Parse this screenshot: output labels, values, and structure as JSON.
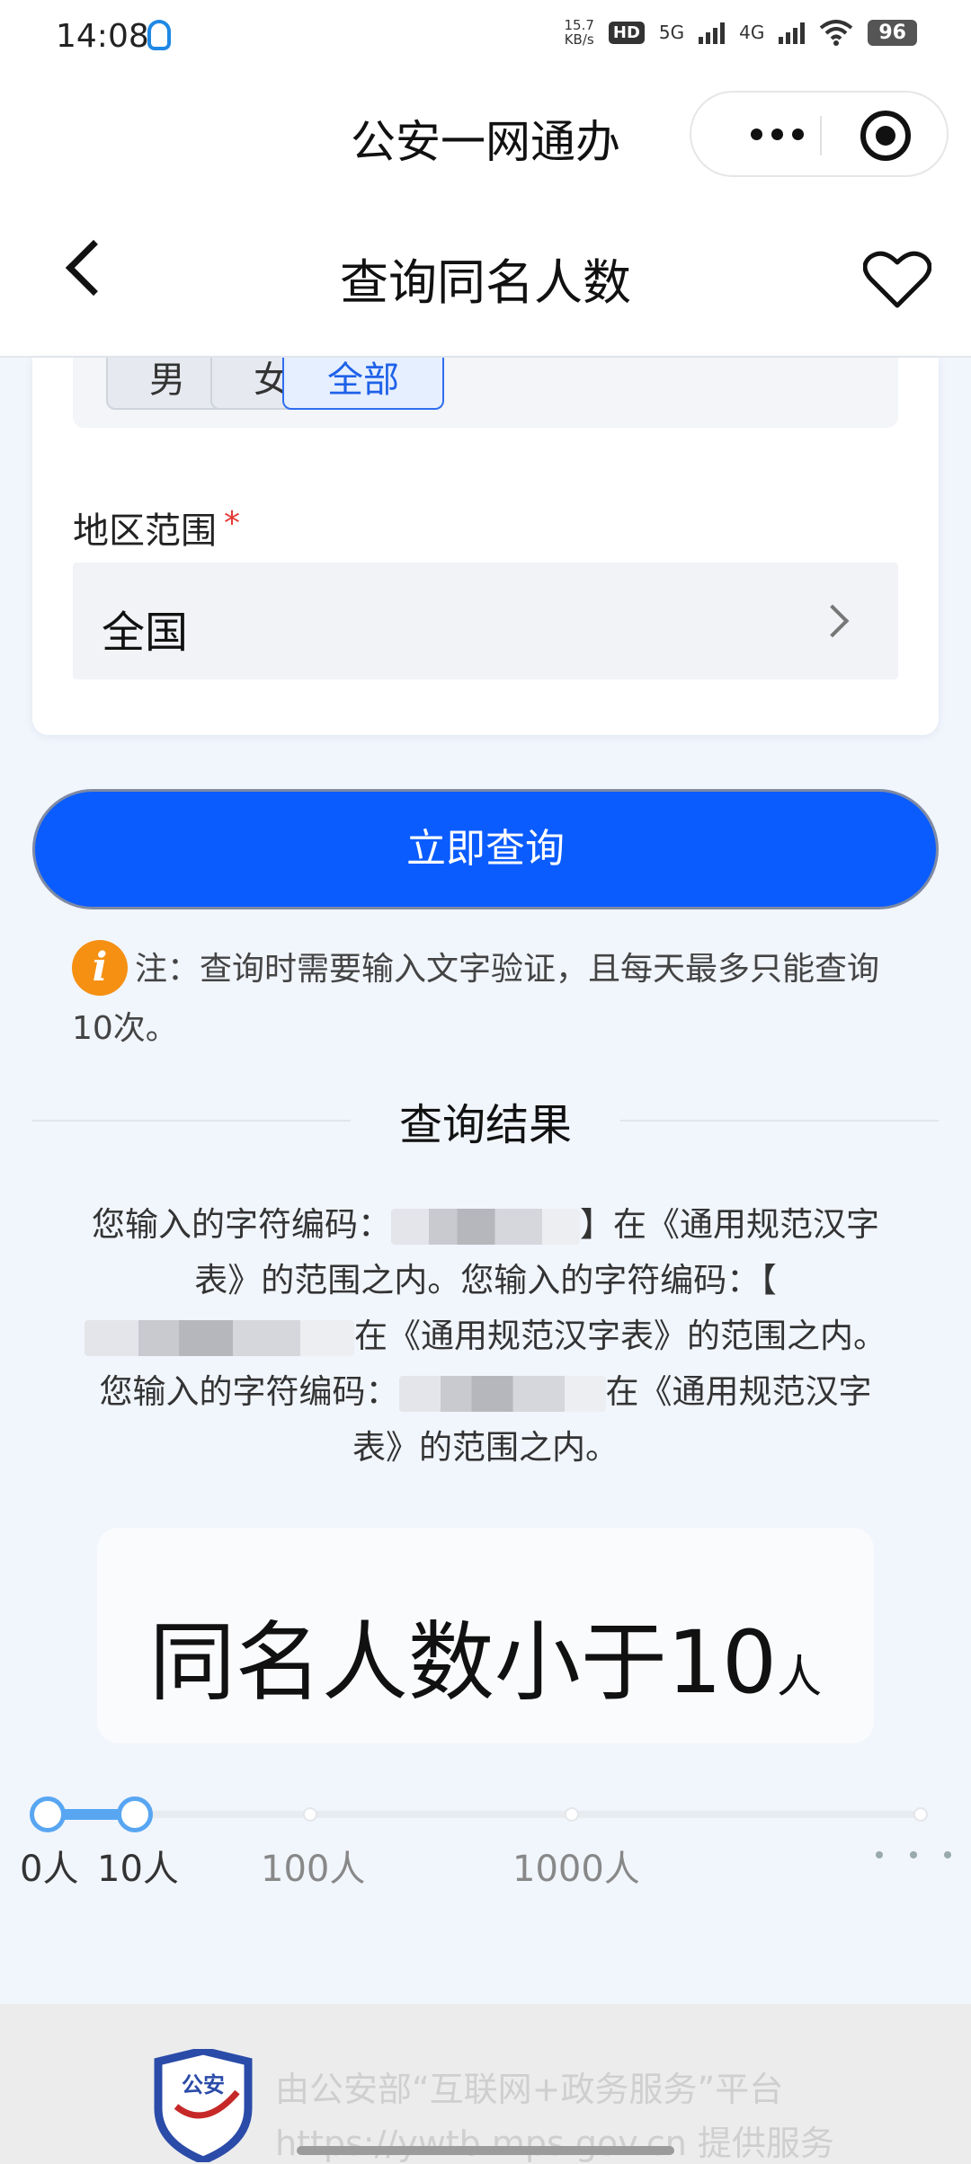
{
  "status_bar": {
    "time": "14:08",
    "speed_value": "15.7",
    "speed_unit": "KB/s",
    "hd_label": "HD",
    "net1": "5G",
    "net2": "4G",
    "battery": "96"
  },
  "mini_program": {
    "title": "公安一网通办"
  },
  "header": {
    "title": "查询同名人数"
  },
  "form": {
    "gender_options": [
      "男",
      "女",
      "全部"
    ],
    "gender_selected": "全部",
    "region_label": "地区范围",
    "required_mark": "*",
    "region_value": "全国"
  },
  "query_button": "立即查询",
  "note": "注：查询时需要输入文字验证，且每天最多只能查询10次。",
  "note_icon": "i",
  "result": {
    "title": "查询结果",
    "part1": "您输入的字符编码：",
    "part2": "】在《通用规范汉字表》的范围之内。您输入的字符编码：【",
    "part3": "在《通用规范汉字表》的范围之内。您输入的字符编码：",
    "part4": "在《通用规范汉字表》的范围之内。",
    "count_main": "同名人数小于10",
    "count_unit": "人"
  },
  "scale": {
    "ticks": [
      "0人",
      "10人",
      "100人",
      "1000人"
    ],
    "active_level": 1
  },
  "footer": {
    "logo_text": "公安",
    "line1": "由公安部“互联网+政务服务”平台",
    "line2": "https://ywtb.mps.gov.cn 提供服务"
  },
  "colors": {
    "primary": "#0a5cff",
    "accent_light": "#58a6f2",
    "warning": "#f59012",
    "required": "#e53935"
  }
}
